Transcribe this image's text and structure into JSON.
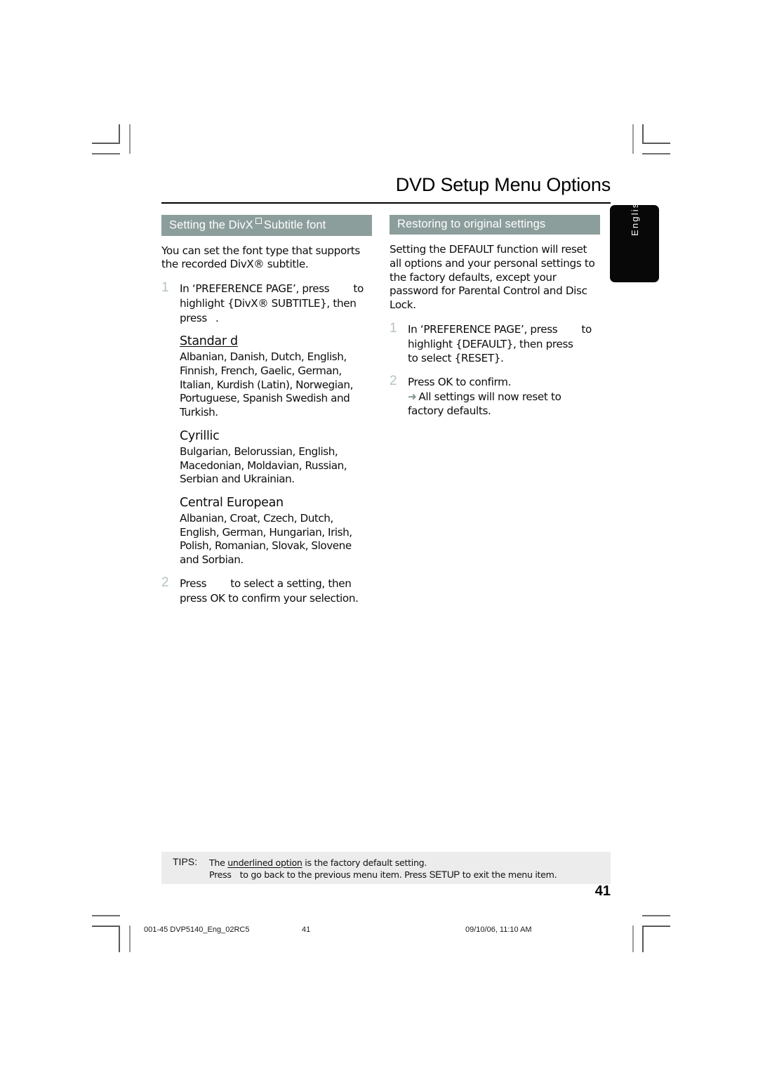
{
  "document": {
    "title": "DVD Setup Menu Options",
    "language_tab": "English",
    "page_number": "41"
  },
  "left_column": {
    "section_heading_prefix": "Setting the DivX",
    "section_heading_suffix": "Subtitle font",
    "intro": "You can set the font type that supports the recorded DivX® subtitle.",
    "steps": [
      {
        "number": "1",
        "text_before_gap": "In ‘PREFERENCE PAGE’, press",
        "text_after_gap": "to highlight {DivX® SUBTITLE}, then press",
        "text_end": "."
      },
      {
        "number": "2",
        "text_before_gap": "Press",
        "text_after_gap": "to select a setting, then press OK  to confirm your selection.",
        "text_end": ""
      }
    ],
    "font_groups": [
      {
        "name": "Standar d",
        "underlined": true,
        "languages": "Albanian, Danish, Dutch, English, Finnish, French, Gaelic, German, Italian, Kurdish (Latin), Norwegian, Portuguese, Spanish Swedish and Turkish."
      },
      {
        "name": "Cyrillic",
        "underlined": false,
        "languages": "Bulgarian, Belorussian, English, Macedonian, Moldavian, Russian, Serbian and Ukrainian."
      },
      {
        "name": "Central European",
        "underlined": false,
        "languages": "Albanian, Croat, Czech, Dutch, English, German, Hungarian, Irish, Polish, Romanian, Slovak, Slovene and Sorbian."
      }
    ]
  },
  "right_column": {
    "section_heading": "Restoring to original settings",
    "intro": "Setting the DEFAULT function will reset all options and your personal settings to the factory defaults, except your password for Parental Control and Disc Lock.",
    "steps": [
      {
        "number": "1",
        "part_a": "In ‘PREFERENCE PAGE’, press",
        "part_b": "to highlight {DEFAULT}, then press",
        "part_c": "to select {RESET}."
      },
      {
        "number": "2",
        "part_a": "Press OK  to confirm.",
        "part_b": "",
        "part_c": ""
      }
    ],
    "result": {
      "arrow": "➜",
      "text": "All settings will now reset to factory defaults."
    }
  },
  "tips": {
    "label": "TIPS:",
    "line1_before": "The ",
    "line1_underlined": "underlined option",
    "line1_after": " is the factory default setting.",
    "line2_before": "Press",
    "line2_middle": "to go back to the previous menu item. Press ",
    "line2_keyword": "SETUP",
    "line2_after": " to exit the menu item."
  },
  "print_footer": {
    "file": "001-45 DVP5140_Eng_02RC5",
    "page": "41",
    "date": "09/10/06, 11:10 AM"
  },
  "colors": {
    "section_header_bg": "#8c9e9b",
    "tips_bg": "#ececec",
    "step_number": "#b4c3c2",
    "arrow": "#7d918f",
    "tab_bg": "#080808"
  }
}
